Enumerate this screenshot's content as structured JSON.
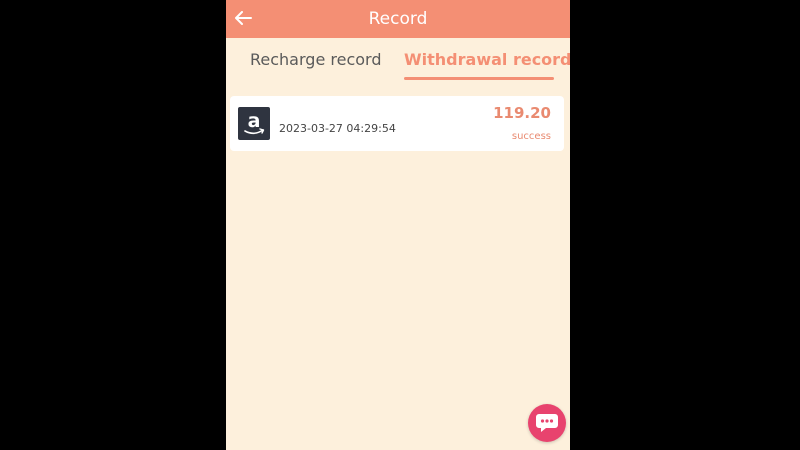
{
  "header": {
    "title": "Record",
    "back_icon": "arrow-left-icon"
  },
  "tabs": [
    {
      "label": "Recharge record",
      "active": false
    },
    {
      "label": "Withdrawal record",
      "active": true
    }
  ],
  "records": [
    {
      "logo": "amazon-logo",
      "time": "2023-03-27 04:29:54",
      "amount": "119.20",
      "status": "success"
    }
  ],
  "chat_button": {
    "icon": "chat-bubble-icon"
  },
  "colors": {
    "accent": "#f48f74",
    "background": "#fdf0dc",
    "card": "#ffffff",
    "chat_button": "#e8436e",
    "outer": "#000000"
  }
}
